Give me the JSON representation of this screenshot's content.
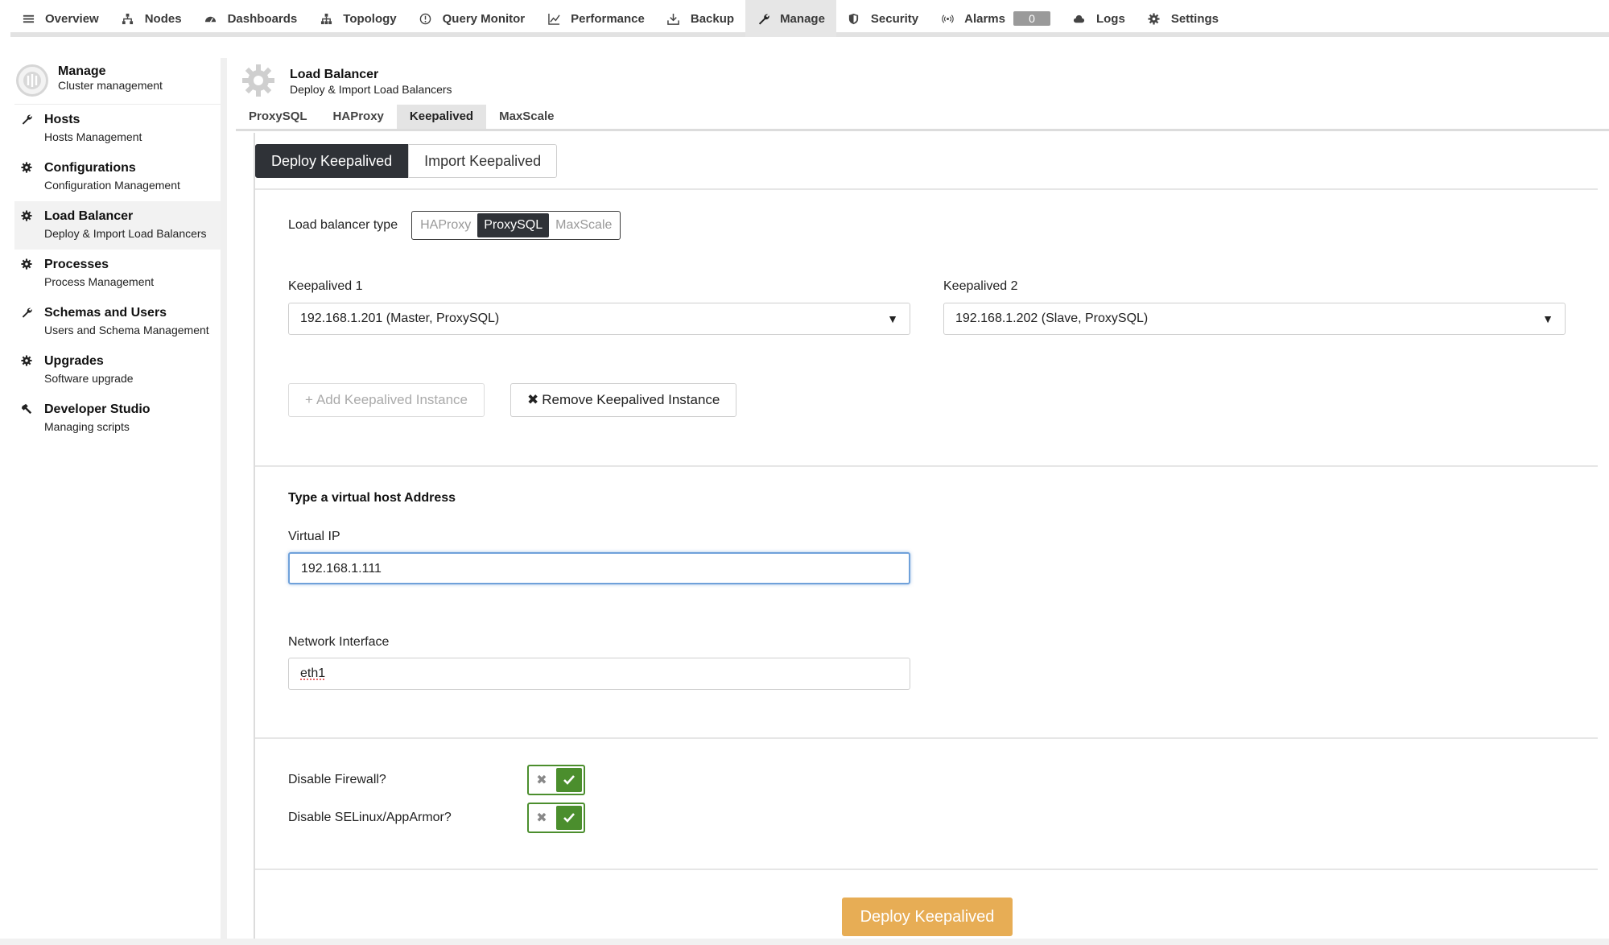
{
  "nav": {
    "items": [
      {
        "label": "Overview",
        "icon": "menu-icon"
      },
      {
        "label": "Nodes",
        "icon": "nodes-icon"
      },
      {
        "label": "Dashboards",
        "icon": "dashboard-icon"
      },
      {
        "label": "Topology",
        "icon": "topology-icon"
      },
      {
        "label": "Query Monitor",
        "icon": "query-monitor-icon"
      },
      {
        "label": "Performance",
        "icon": "chart-icon"
      },
      {
        "label": "Backup",
        "icon": "backup-icon"
      },
      {
        "label": "Manage",
        "icon": "wrench-icon",
        "active": true
      },
      {
        "label": "Security",
        "icon": "shield-icon"
      },
      {
        "label": "Alarms",
        "icon": "broadcast-icon",
        "badge": "0"
      },
      {
        "label": "Logs",
        "icon": "cloud-icon"
      },
      {
        "label": "Settings",
        "icon": "gear-icon"
      }
    ]
  },
  "sidebar": {
    "title": "Manage",
    "subtitle": "Cluster management",
    "items": [
      {
        "label": "Hosts",
        "desc": "Hosts Management",
        "icon": "wrench-icon"
      },
      {
        "label": "Configurations",
        "desc": "Configuration Management",
        "icon": "gear-icon"
      },
      {
        "label": "Load Balancer",
        "desc": "Deploy & Import Load Balancers",
        "icon": "gear-icon",
        "active": true
      },
      {
        "label": "Processes",
        "desc": "Process Management",
        "icon": "gear-icon"
      },
      {
        "label": "Schemas and Users",
        "desc": "Users and Schema Management",
        "icon": "wrench-icon"
      },
      {
        "label": "Upgrades",
        "desc": "Software upgrade",
        "icon": "gear-icon"
      },
      {
        "label": "Developer Studio",
        "desc": "Managing scripts",
        "icon": "hammer-icon"
      }
    ]
  },
  "header": {
    "title": "Load Balancer",
    "subtitle": "Deploy & Import Load Balancers"
  },
  "subtabs": [
    "ProxySQL",
    "HAProxy",
    "Keepalived",
    "MaxScale"
  ],
  "active_subtab": "Keepalived",
  "mode_tabs": {
    "deploy": "Deploy Keepalived",
    "import": "Import Keepalived"
  },
  "lb_type": {
    "label": "Load balancer type",
    "options": [
      "HAProxy",
      "ProxySQL",
      "MaxScale"
    ],
    "selected": "ProxySQL"
  },
  "keepalived1": {
    "label": "Keepalived 1",
    "value": "192.168.1.201 (Master, ProxySQL)"
  },
  "keepalived2": {
    "label": "Keepalived 2",
    "value": "192.168.1.202 (Slave, ProxySQL)"
  },
  "buttons": {
    "add_instance": "Add Keepalived Instance",
    "remove_instance": "Remove Keepalived Instance",
    "deploy": "Deploy Keepalived"
  },
  "virtual_host": {
    "section_title": "Type a virtual host Address",
    "vip_label": "Virtual IP",
    "vip_value": "192.168.1.111",
    "iface_label": "Network Interface",
    "iface_value": "eth1"
  },
  "toggles": {
    "firewall": {
      "label": "Disable Firewall?",
      "on": true
    },
    "selinux": {
      "label": "Disable SELinux/AppArmor?",
      "on": true
    }
  },
  "colors": {
    "accent_dark": "#2f3237",
    "toggle_green": "#4b8e2d",
    "deploy_orange": "#e7ad55",
    "focus_blue": "#6fa1da"
  }
}
